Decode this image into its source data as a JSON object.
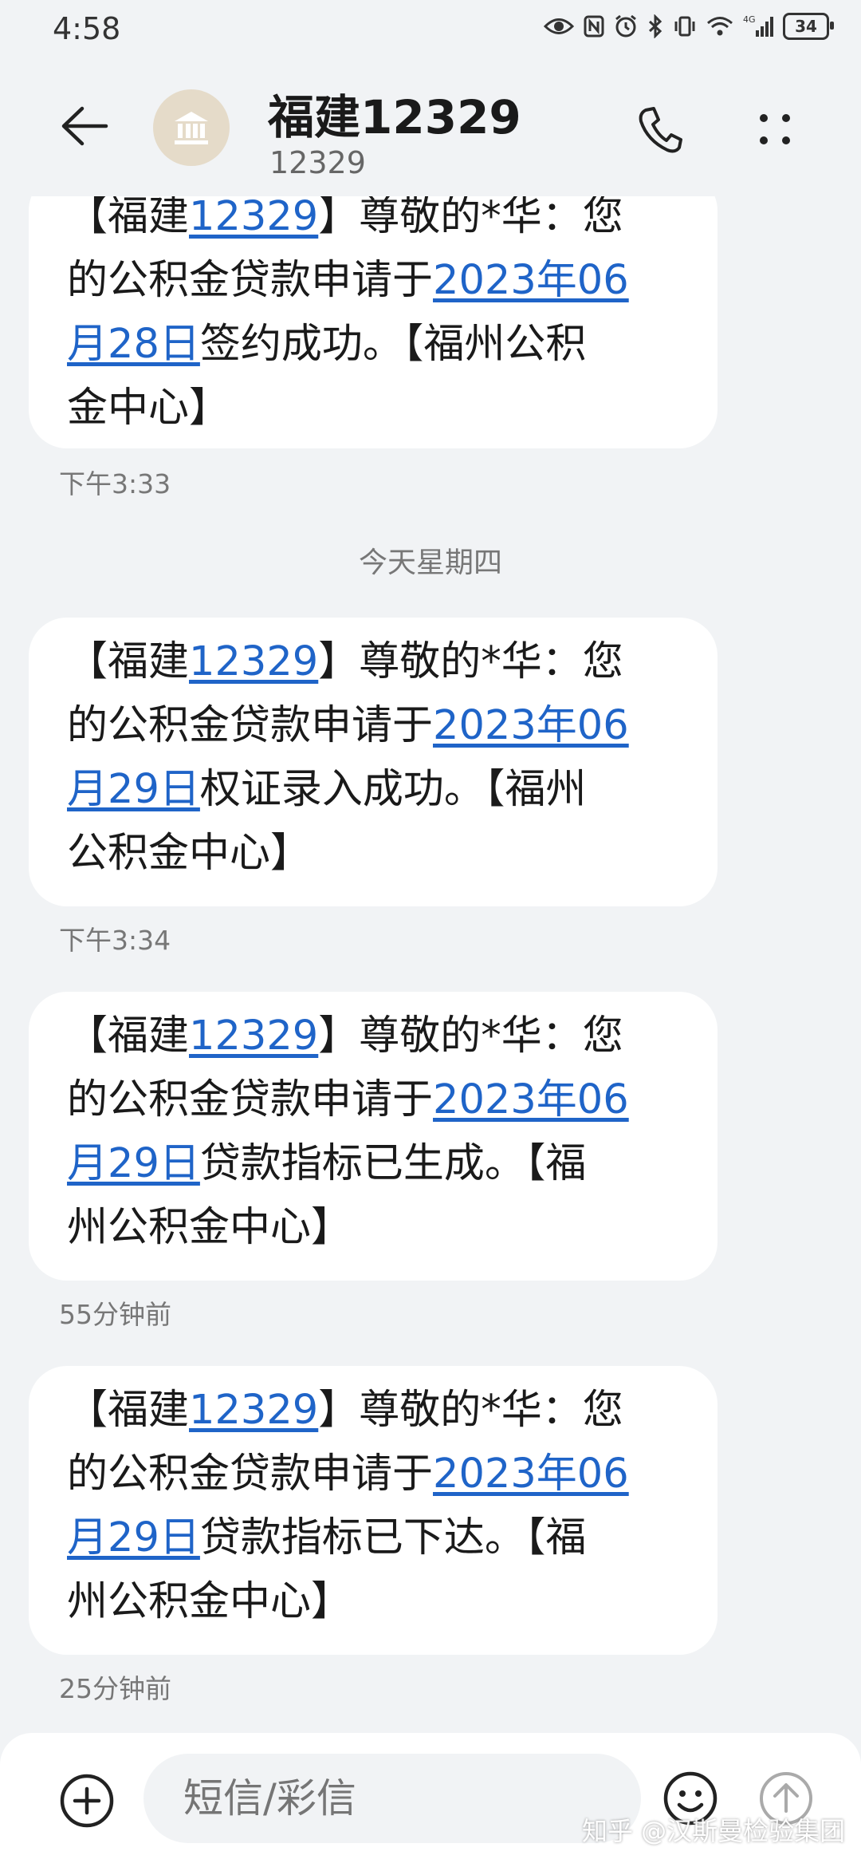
{
  "status_bar": {
    "time": "4:58",
    "icons": [
      "eye-icon",
      "nfc-icon",
      "alarm-icon",
      "bluetooth-icon",
      "vibrate-icon",
      "wifi-icon",
      "signal-icon"
    ],
    "network": "4G",
    "battery": "34"
  },
  "header": {
    "title": "福建12329",
    "number": "12329",
    "avatar_icon": "bank-icon"
  },
  "messages": [
    {
      "lines": [
        {
          "pre": "【福建",
          "link": "12329",
          "post": "】尊敬的*华：您"
        },
        {
          "pre": "的公积金贷款申请于",
          "link": "2023年06",
          "post": ""
        },
        {
          "pre": "",
          "link": "月28日",
          "post": "签约成功。【福州公积"
        },
        {
          "pre": "金中心】",
          "link": "",
          "post": ""
        }
      ],
      "time": "下午3:33"
    },
    {
      "lines": [
        {
          "pre": "【福建",
          "link": "12329",
          "post": "】尊敬的*华：您"
        },
        {
          "pre": "的公积金贷款申请于",
          "link": "2023年06",
          "post": ""
        },
        {
          "pre": "",
          "link": "月29日",
          "post": "权证录入成功。【福州"
        },
        {
          "pre": "公积金中心】",
          "link": "",
          "post": ""
        }
      ],
      "time": "下午3:34"
    },
    {
      "lines": [
        {
          "pre": "【福建",
          "link": "12329",
          "post": "】尊敬的*华：您"
        },
        {
          "pre": "的公积金贷款申请于",
          "link": "2023年06",
          "post": ""
        },
        {
          "pre": "",
          "link": "月29日",
          "post": "贷款指标已生成。【福"
        },
        {
          "pre": "州公积金中心】",
          "link": "",
          "post": ""
        }
      ],
      "time": "55分钟前"
    },
    {
      "lines": [
        {
          "pre": "【福建",
          "link": "12329",
          "post": "】尊敬的*华：您"
        },
        {
          "pre": "的公积金贷款申请于",
          "link": "2023年06",
          "post": ""
        },
        {
          "pre": "",
          "link": "月29日",
          "post": "贷款指标已下达。【福"
        },
        {
          "pre": "州公积金中心】",
          "link": "",
          "post": ""
        }
      ],
      "time": "25分钟前"
    }
  ],
  "day_separator": "今天星期四",
  "composer": {
    "placeholder": "短信/彩信"
  },
  "watermark": "知乎 @汉斯曼检验集团",
  "colors": {
    "background": "#f1f3f5",
    "bubble": "#ffffff",
    "link": "#1f64c8",
    "avatar_bg": "#e5dbc9"
  }
}
